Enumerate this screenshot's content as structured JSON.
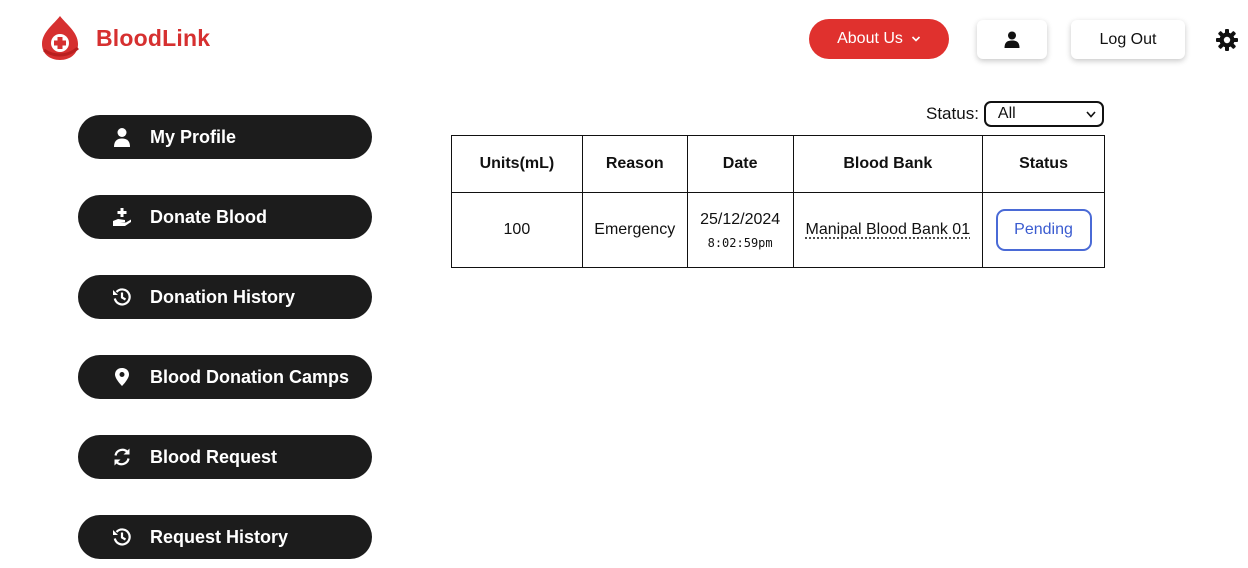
{
  "header": {
    "brand": "BloodLink",
    "about_label": "About Us",
    "logout_label": "Log Out",
    "accent_color": "#e0312e"
  },
  "sidebar": {
    "items": [
      {
        "label": "My Profile",
        "icon": "user-icon"
      },
      {
        "label": "Donate Blood",
        "icon": "hand-holding-medical-icon"
      },
      {
        "label": "Donation History",
        "icon": "history-icon"
      },
      {
        "label": "Blood Donation Camps",
        "icon": "location-pin-icon"
      },
      {
        "label": "Blood Request",
        "icon": "sync-icon"
      },
      {
        "label": "Request History",
        "icon": "history-icon"
      }
    ]
  },
  "filter": {
    "label": "Status:",
    "selected": "All"
  },
  "table": {
    "headers": [
      "Units(mL)",
      "Reason",
      "Date",
      "Blood Bank",
      "Status"
    ],
    "rows": [
      {
        "units": "100",
        "reason": "Emergency",
        "date": "25/12/2024",
        "time": "8:02:59pm",
        "bank": "Manipal Blood Bank 01",
        "status": "Pending"
      }
    ]
  }
}
